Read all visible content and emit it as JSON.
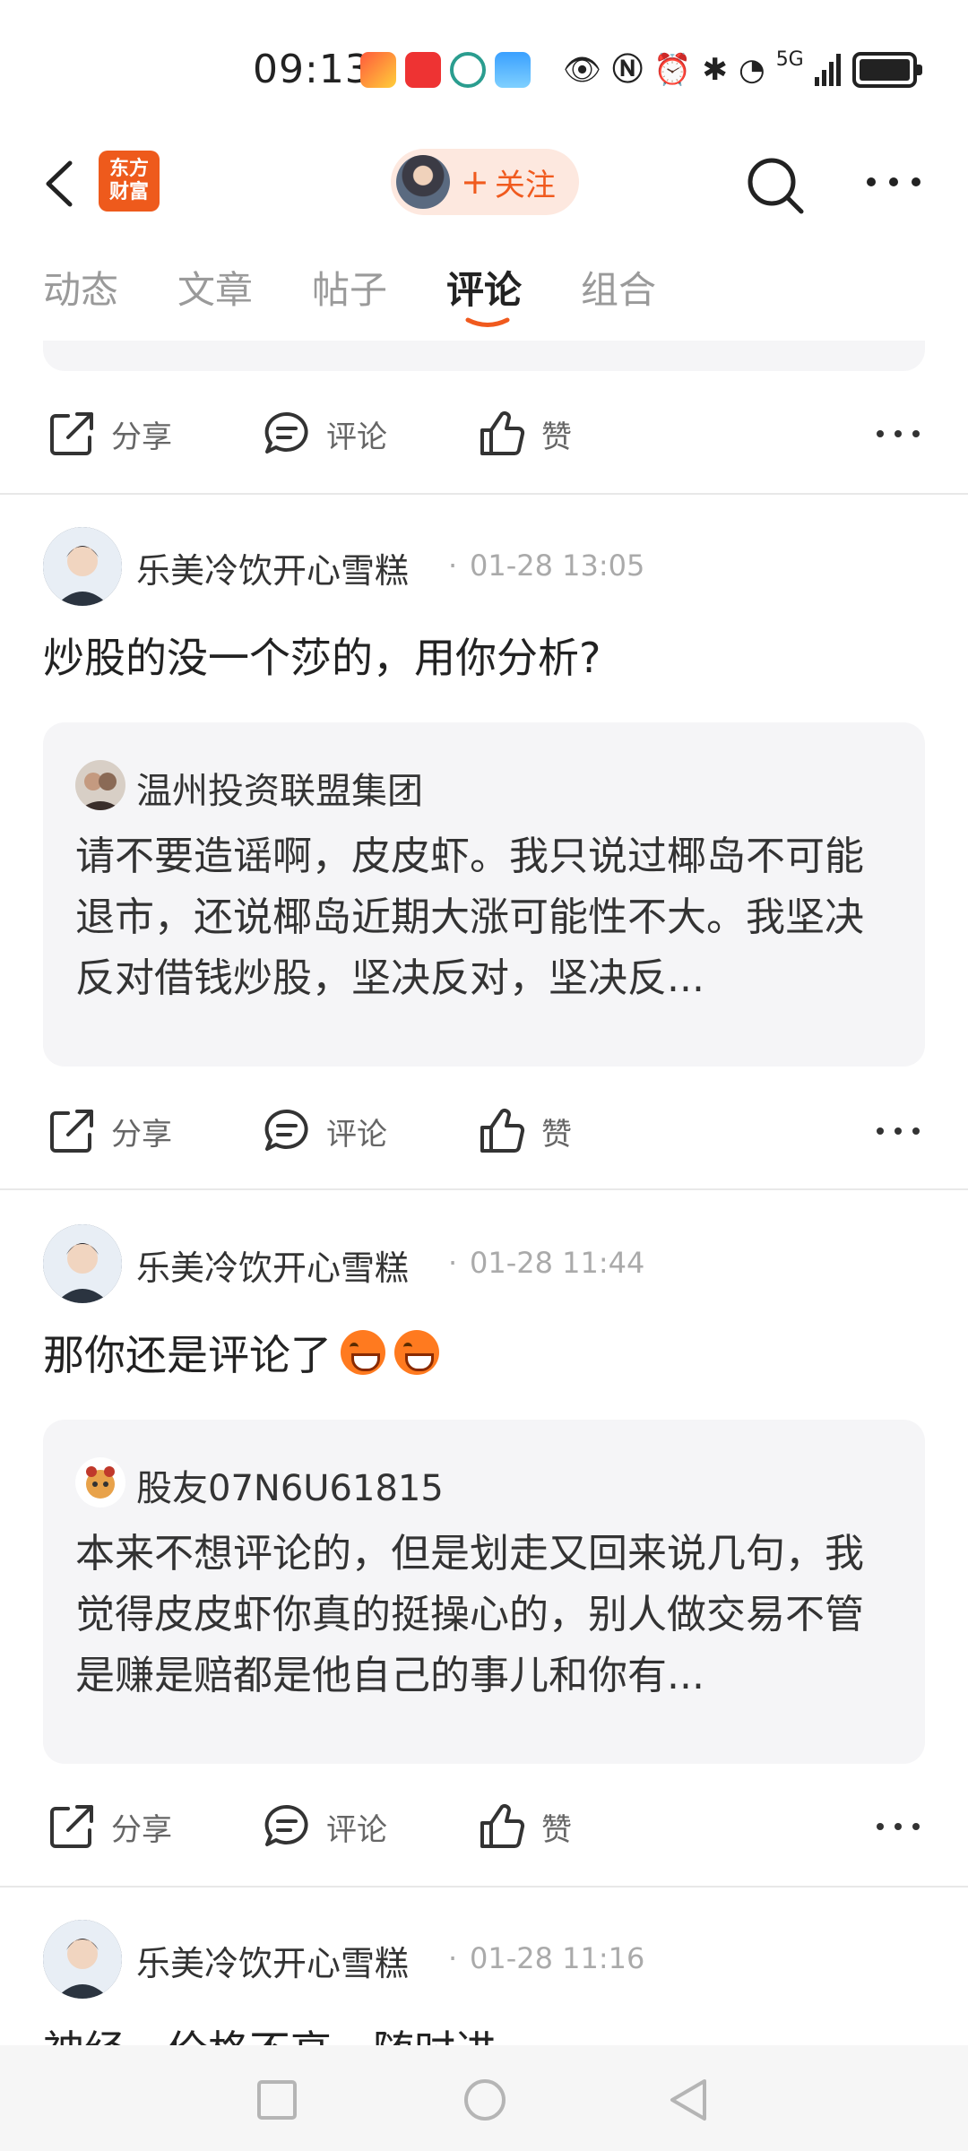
{
  "status_bar": {
    "time": "09:13",
    "network": "5G",
    "icons": [
      "notification-app-icon",
      "app-icon",
      "app-icon",
      "weather-icon",
      "eye-icon",
      "nfc-icon",
      "alarm-icon",
      "bluetooth-icon",
      "wifi-icon",
      "signal-icon",
      "battery-icon"
    ]
  },
  "header": {
    "logo_text_line1": "东方",
    "logo_text_line2": "财富",
    "follow_plus": "+",
    "follow_label": "关注"
  },
  "tabs": [
    {
      "label": "动态",
      "active": false
    },
    {
      "label": "文章",
      "active": false
    },
    {
      "label": "帖子",
      "active": false
    },
    {
      "label": "评论",
      "active": true
    },
    {
      "label": "组合",
      "active": false
    }
  ],
  "actions": {
    "share": "分享",
    "comment": "评论",
    "like": "赞"
  },
  "posts": [
    {
      "author": "乐美冷饮开心雪糕",
      "separator": "·",
      "time": "01-28 13:05",
      "content": "炒股的没一个莎的，用你分析?",
      "quote": {
        "name": "温州投资联盟集团",
        "text": "请不要造谣啊，皮皮虾。我只说过椰岛不可能退市，还说椰岛近期大涨可能性不大。我坚决反对借钱炒股，坚决反对，坚决反..."
      }
    },
    {
      "author": "乐美冷饮开心雪糕",
      "separator": "·",
      "time": "01-28 11:44",
      "content": "那你还是评论了",
      "quote": {
        "name": "股友07N6U61815",
        "text": "本来不想评论的，但是划走又回来说几句，我觉得皮皮虾你真的挺操心的，别人做交易不管是赚是赔都是他自己的事儿和你有..."
      }
    },
    {
      "author": "乐美冷饮开心雪糕",
      "separator": "·",
      "time": "01-28 11:16",
      "content": "神经，价格不高，随时进"
    }
  ],
  "colors": {
    "accent": "#f05a1e",
    "card_bg": "#f5f5f7",
    "muted": "#999999"
  }
}
